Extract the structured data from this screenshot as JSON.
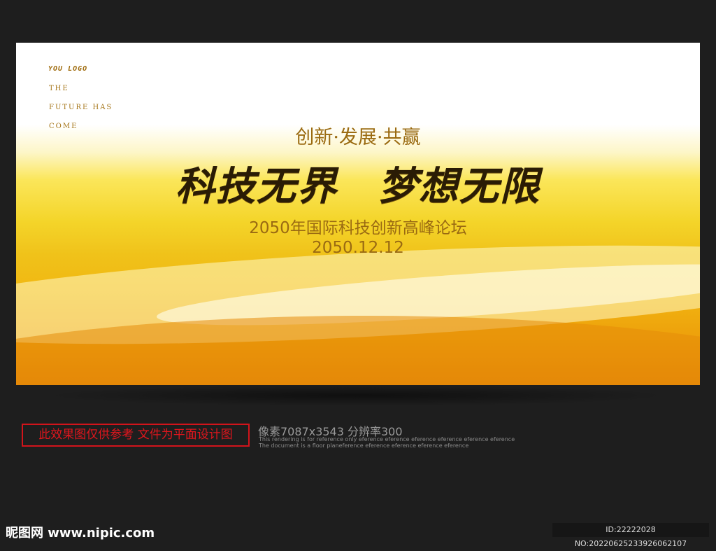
{
  "poster": {
    "logo": "YOU LOGO",
    "tagline": [
      "THE",
      "FUTURE HAS",
      "COME"
    ],
    "subtitle": "创新·发展·共赢",
    "title": "科技无界　梦想无限",
    "forum": "2050年国际科技创新高峰论坛",
    "date": "2050.12.12"
  },
  "info": {
    "notice": "此效果图仅供参考 文件为平面设计图",
    "pixels": "像素7087x3543  分辨率300",
    "ref1": "This rendering is for reference only  eference eference eference eference eference eference",
    "ref2": "The document is a floor planeference eference eference eference eference"
  },
  "footer": {
    "site": "昵图网 www.nipic.com",
    "id": "ID:22222028 NO:20220625233926062107"
  },
  "colors": {
    "gold": "#a06d10",
    "red": "#d2141b"
  }
}
